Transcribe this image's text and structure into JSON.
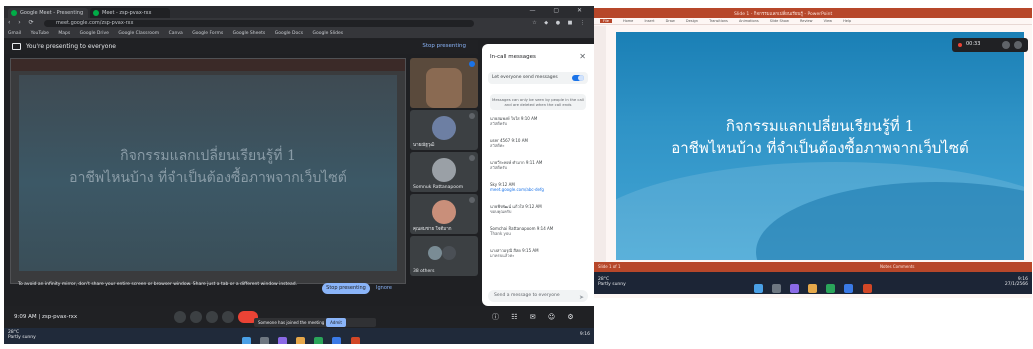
{
  "left": {
    "browser": {
      "tabs": [
        "Google Meet - Presenting",
        "Meet - zsp-pvax-rxx"
      ],
      "url": "meet.google.com/zsp-pvax-rxx",
      "bookmarks": [
        "Gmail",
        "YouTube",
        "Maps",
        "Google Drive",
        "Google Classroom",
        "Canva",
        "Google Forms",
        "Google Sheets",
        "Google Docs",
        "Google Slides"
      ]
    },
    "meet": {
      "presenting_label": "You're presenting to everyone",
      "stop_presenting_top": "Stop presenting",
      "slide_line1": "กิจกรรมแลกเปลี่ยนเรียนรู้ที่ 1",
      "slide_line2": "อาชีพไหนบ้าง ที่จำเป็นต้องซื้อภาพจากเว็บไซต์",
      "warning": "To avoid an infinity mirror, don't share your entire screen or browser window. Share just a tab or a different window instead.",
      "stop_presenting_button": "Stop presenting",
      "dismiss": "Ignore",
      "participants": [
        {
          "name": "",
          "avatar_color": "#8a6a52"
        },
        {
          "name": "นายณัฐวุฒิ",
          "avatar_color": "#6d7fa3"
        },
        {
          "name": "Somnuk Rattanapoom",
          "avatar_color": "#9aa0a6"
        },
        {
          "name": "คุณสมชาย ใจดีมาก",
          "avatar_color": "#c98f7a"
        },
        {
          "name": "38 others",
          "avatar_color": "#7a8c95"
        }
      ],
      "chat": {
        "title": "In-call messages",
        "toggle_label": "Let everyone send messages",
        "note": "Messages can only be seen by people in the call and are deleted when the call ends",
        "messages": [
          {
            "who": "นายสมพงษ์ ใจใส 9:10 AM",
            "text": "สวัสดีครับ"
          },
          {
            "who": "user 4567 9:10 AM",
            "text": "สวัสดีค่ะ"
          },
          {
            "who": "นายวีระพงษ์ คำมาก 9:11 AM",
            "text": "สวัสดีครับ"
          },
          {
            "who": "Sky 9:12 AM",
            "text": "meet.google.com/abc-defg",
            "link": true
          },
          {
            "who": "นายพีรพัฒน์ แก้วใส 9:12 AM",
            "text": "ขอบคุณครับ"
          },
          {
            "who": "Somchai Rattanapoom 9:14 AM",
            "text": "Thank you"
          },
          {
            "who": "นางสาวอรุณี สีสด 9:15 AM",
            "text": "มาครบแล้วค่ะ"
          }
        ],
        "input_placeholder": "Send a message to everyone"
      },
      "time_code": "9:09 AM | zsp-pvax-rxx",
      "notice": "Someone has joined the meeting",
      "notice_button": "Admit"
    },
    "taskbar": {
      "weather_temp": "28°C",
      "weather_desc": "Partly sunny",
      "clock": "9:16"
    }
  },
  "right": {
    "ppt": {
      "window_title": "Slide 1 - กิจกรรมแลกเปลี่ยนเรียนรู้ - PowerPoint",
      "ribbon_tabs": [
        "File",
        "Home",
        "Insert",
        "Draw",
        "Design",
        "Transitions",
        "Animations",
        "Slide Show",
        "Review",
        "View",
        "Help"
      ],
      "slide_line1": "กิจกรรมแลกเปลี่ยนเรียนรู้ที่ 1",
      "slide_line2": "อาชีพไหนบ้าง ที่จำเป็นต้องซื้อภาพจากเว็บไซต์",
      "rec_time": "00:33",
      "status_left": "Slide 1 of 1",
      "status_right": "Notes   Comments"
    },
    "taskbar": {
      "weather_temp": "28°C",
      "weather_desc": "Partly sunny",
      "clock_time": "9:16",
      "clock_date": "27/1/2566"
    }
  }
}
